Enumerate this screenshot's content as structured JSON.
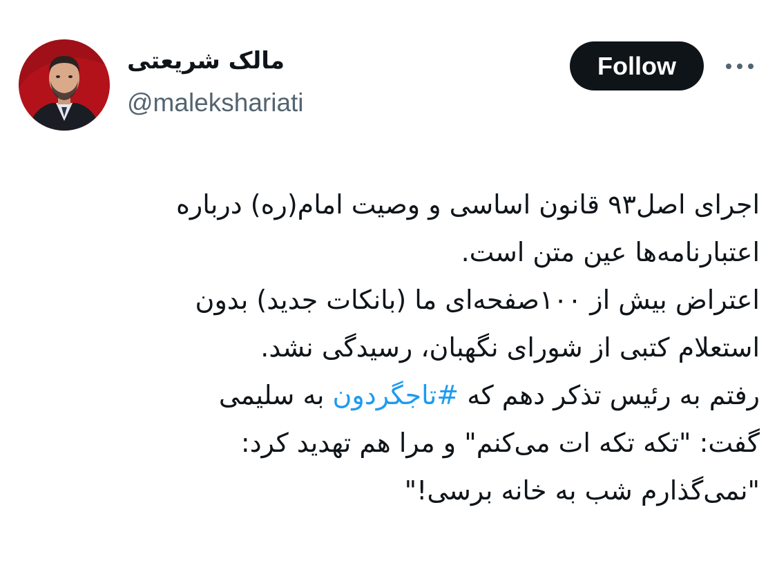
{
  "author": {
    "display_name": "مالک شریعتی",
    "handle": "@malekshariati",
    "avatar_bg": "#b3121b"
  },
  "actions": {
    "follow_label": "Follow",
    "more_icon": "more-dots-icon"
  },
  "tweet": {
    "lines": [
      "اجرای اصل۹۳ قانون اساسی و وصیت امام(ره) درباره",
      "اعتبارنامه‌ها عین متن است.",
      "اعتراض بیش از ۱۰۰صفحه‌ای ما (بانکات جدید) بدون",
      "استعلام کتبی از شورای نگهبان، رسیدگی نشد.",
      "رفتم به رئیس تذکر دهم که",
      "به سلیمی",
      "گفت: \"تکه تکه ات می‌کنم\" و مرا هم تهدید کرد:",
      "\"نمی‌گذارم شب به خانه برسی!\""
    ],
    "hashtag": "#تاجگردون"
  },
  "colors": {
    "link": "#1d9bf0",
    "text": "#0f1419",
    "secondary": "#536471",
    "button_bg": "#0f1419"
  }
}
